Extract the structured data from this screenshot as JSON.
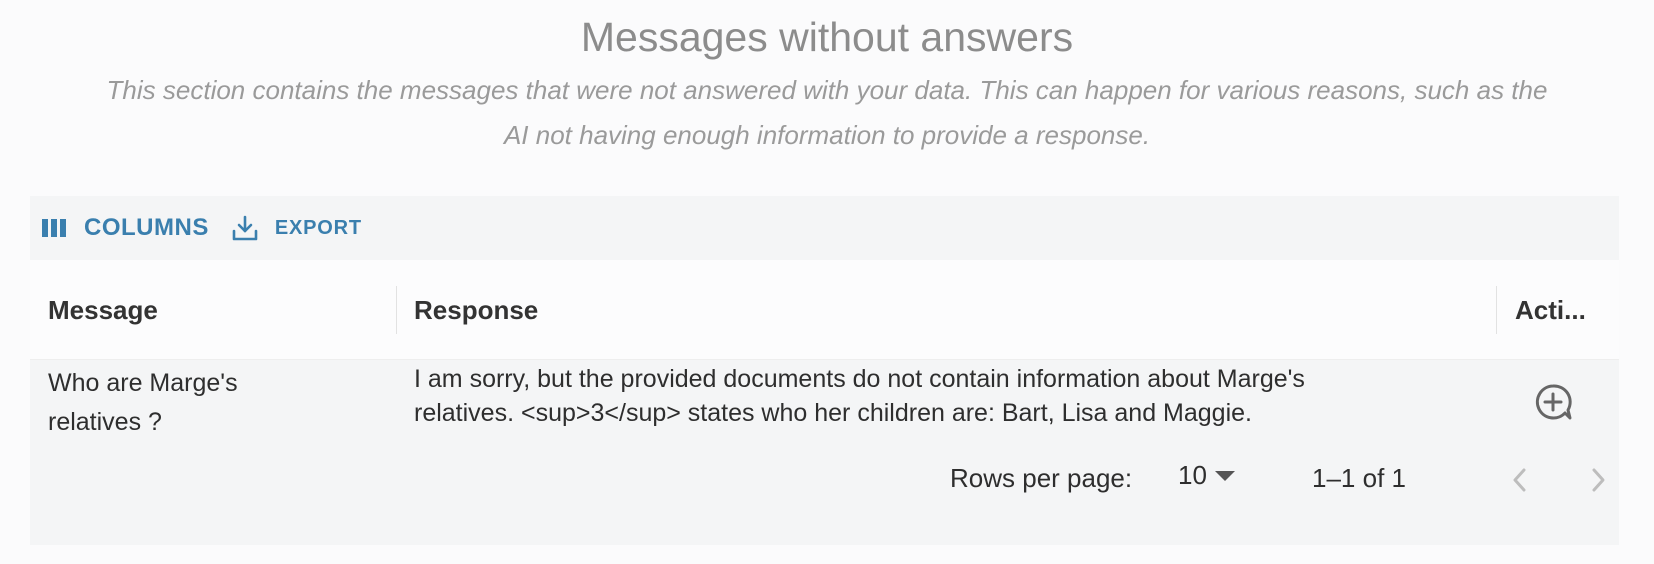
{
  "header": {
    "title": "Messages without answers",
    "subtitle_line1": "This section contains the messages that were not answered with your data. This can happen for various reasons, such as the",
    "subtitle_line2": "AI not having enough information to provide a response."
  },
  "toolbar": {
    "columns_label": "COLUMNS",
    "export_label": "EXPORT"
  },
  "table": {
    "columns": [
      "Message",
      "Response",
      "Acti..."
    ],
    "rows": [
      {
        "message_line1": "Who are Marge's",
        "message_line2": "relatives ?",
        "response_line1": "I am sorry, but the provided documents do not contain information about Marge's",
        "response_line2": "relatives. <sup>3</sup> states who her children are: Bart, Lisa and Maggie.",
        "action_icon": "comment-zoom-icon"
      }
    ]
  },
  "pagination": {
    "rows_per_page_label": "Rows per page:",
    "rows_per_page_value": "10",
    "range": "1–1 of 1"
  },
  "colors": {
    "accent": "#3a7fae",
    "muted_text": "#8c8c8c",
    "table_bg": "#f4f5f6"
  }
}
